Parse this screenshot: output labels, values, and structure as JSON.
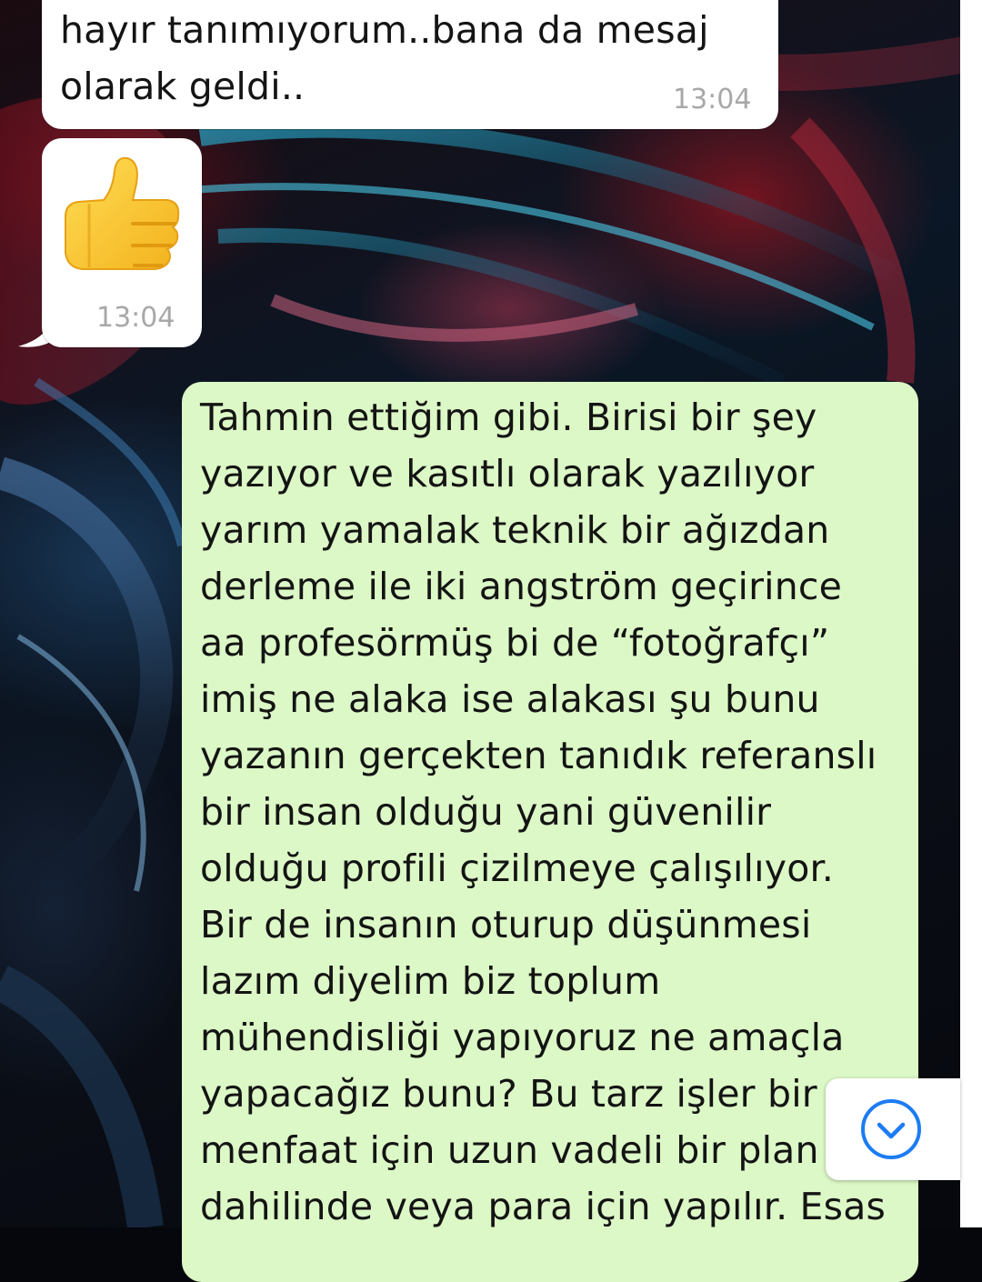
{
  "chat": {
    "messages": [
      {
        "direction": "incoming",
        "text": "hayır tanımıyorum..bana da mesaj\nolarak geldi..",
        "time": "13:04"
      },
      {
        "direction": "incoming",
        "emoji": "thumbs-up",
        "time": "13:04"
      },
      {
        "direction": "outgoing",
        "text": "Tahmin ettiğim gibi. Birisi bir şey\nyazıyor ve kasıtlı olarak yazılıyor\nyarım yamalak teknik bir ağızdan\nderleme ile iki angström geçirince\naa profesörmüş bi de “fotoğrafçı”\nimiş ne alaka ise alakası şu bunu\nyazanın gerçekten tanıdık referanslı\nbir insan olduğu yani güvenilir\nolduğu profili çizilmeye çalışılıyor.\nBir de insanın oturup düşünmesi\nlazım diyelim biz toplum\nmühendisliği yapıyoruz ne amaçla\nyapacağız bunu? Bu tarz işler bir\nmenfaat için uzun vadeli bir plan\ndahilinde veya para için yapılır. Esas"
      }
    ]
  },
  "icons": {
    "scroll_down": "chevron-down-circle-icon",
    "emoji": "thumbs-up-icon"
  },
  "colors": {
    "incoming_bubble": "#ffffff",
    "outgoing_bubble": "#dcf8c6",
    "timestamp": "#a8a8a8",
    "accent": "#1d7cf2"
  }
}
